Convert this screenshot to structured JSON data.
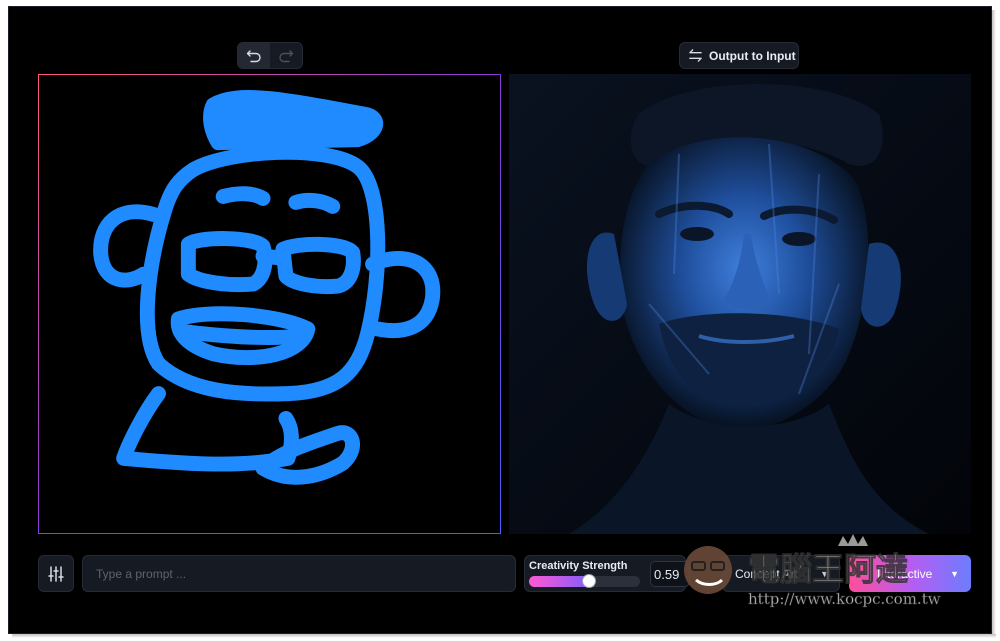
{
  "toolbar_top": {
    "undo_icon": "undo-icon",
    "redo_icon": "redo-icon",
    "output_to_input_label": "Output to Input",
    "output_to_input_icon": "swap-arrows-icon"
  },
  "bottom_bar": {
    "settings_icon": "sliders-icon",
    "prompt_placeholder": "Type a prompt ...",
    "prompt_value": "",
    "strength_label": "Creativity Strength",
    "strength_value": "0.59",
    "style_value": "Concept Art",
    "mode_value": "Interactive"
  },
  "watermark": {
    "title": "電腦王阿達",
    "url": "http://www.kocpc.com.tw"
  },
  "colors": {
    "sketch_stroke": "#1f8bff",
    "accent_pink": "#ff4f9a",
    "accent_blue": "#6d7dff"
  }
}
